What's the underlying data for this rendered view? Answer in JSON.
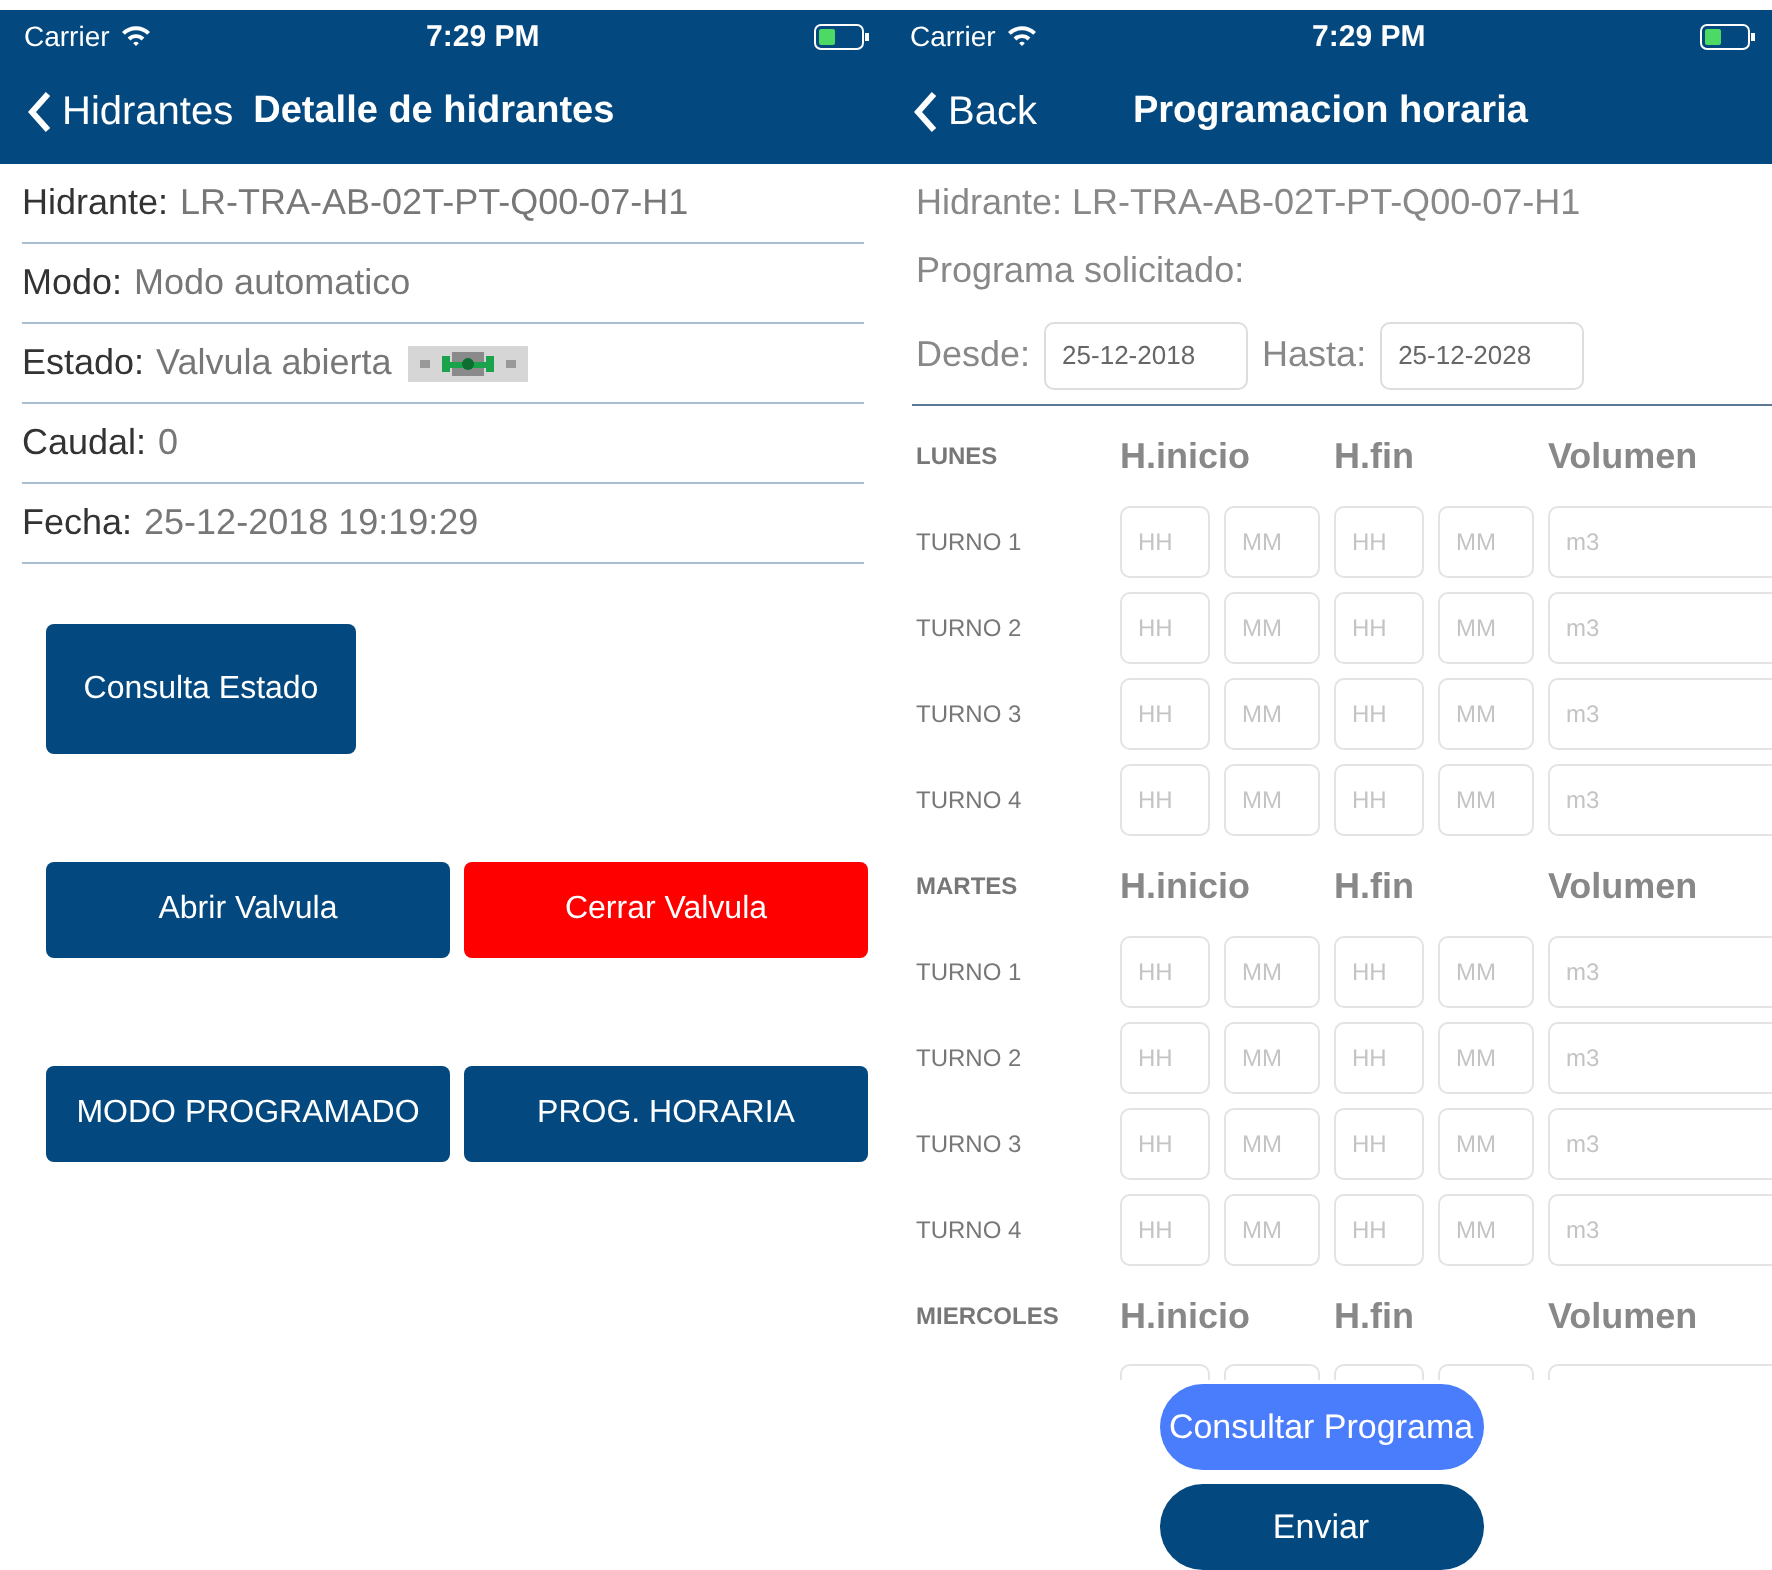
{
  "left": {
    "status": {
      "carrier": "Carrier",
      "time": "7:29 PM"
    },
    "nav": {
      "back": "Hidrantes",
      "title": "Detalle de hidrantes"
    },
    "fields": [
      {
        "label": "Hidrante:",
        "value": "LR-TRA-AB-02T-PT-Q00-07-H1"
      },
      {
        "label": "Modo:",
        "value": "Modo automatico"
      },
      {
        "label": "Estado:",
        "value": "Valvula abierta",
        "kind": "valve"
      },
      {
        "label": "Caudal:",
        "value": "0"
      },
      {
        "label": "Fecha:",
        "value": "25-12-2018 19:19:29"
      }
    ],
    "button_rows": [
      [
        {
          "label": "Consulta Estado",
          "kind": "primary"
        }
      ],
      [
        {
          "label": "Abrir Valvula",
          "kind": "primary"
        },
        {
          "label": "Cerrar Valvula",
          "kind": "danger"
        }
      ],
      [
        {
          "label": "MODO PROGRAMADO",
          "kind": "primary"
        },
        {
          "label": "PROG. HORARIA",
          "kind": "primary"
        }
      ]
    ]
  },
  "right": {
    "status": {
      "carrier": "Carrier",
      "time": "7:29 PM"
    },
    "nav": {
      "back": "Back",
      "title": "Programacion horaria"
    },
    "hidrante": "Hidrante: LR-TRA-AB-02T-PT-Q00-07-H1",
    "programa": "Programa solicitado:",
    "desde": {
      "label": "Desde:",
      "value": "25-12-2018"
    },
    "hasta": {
      "label": "Hasta:",
      "value": "25-12-2028"
    },
    "days": [
      {
        "name": "LUNES",
        "headers": [
          "H.inicio",
          "H.fin",
          "Volumen"
        ],
        "turnos": [
          {
            "label": "TURNO 1",
            "placeholders": [
              "HH",
              "MM",
              "HH",
              "MM",
              "m3"
            ]
          },
          {
            "label": "TURNO 2",
            "placeholders": [
              "HH",
              "MM",
              "HH",
              "MM",
              "m3"
            ]
          },
          {
            "label": "TURNO 3",
            "placeholders": [
              "HH",
              "MM",
              "HH",
              "MM",
              "m3"
            ]
          },
          {
            "label": "TURNO 4",
            "placeholders": [
              "HH",
              "MM",
              "HH",
              "MM",
              "m3"
            ]
          }
        ]
      },
      {
        "name": "MARTES",
        "headers": [
          "H.inicio",
          "H.fin",
          "Volumen"
        ],
        "turnos": [
          {
            "label": "TURNO 1",
            "placeholders": [
              "HH",
              "MM",
              "HH",
              "MM",
              "m3"
            ]
          },
          {
            "label": "TURNO 2",
            "placeholders": [
              "HH",
              "MM",
              "HH",
              "MM",
              "m3"
            ]
          },
          {
            "label": "TURNO 3",
            "placeholders": [
              "HH",
              "MM",
              "HH",
              "MM",
              "m3"
            ]
          },
          {
            "label": "TURNO 4",
            "placeholders": [
              "HH",
              "MM",
              "HH",
              "MM",
              "m3"
            ]
          }
        ]
      },
      {
        "name": "MIERCOLES",
        "headers": [
          "H.inicio",
          "H.fin",
          "Volumen"
        ],
        "partial_row": true
      }
    ],
    "buttons": [
      {
        "label": "Consultar Programa",
        "kind": "secondary"
      },
      {
        "label": "Enviar",
        "kind": "primary"
      }
    ]
  }
}
